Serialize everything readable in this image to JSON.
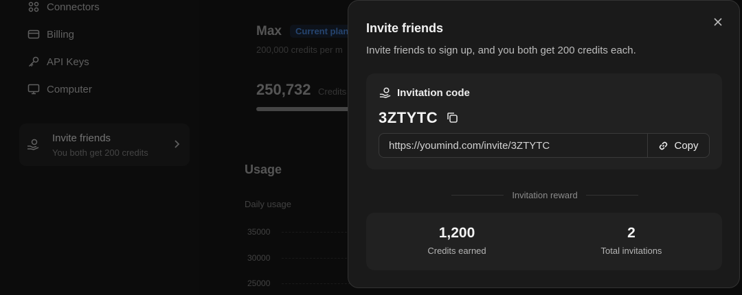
{
  "sidebar": {
    "items": [
      {
        "label": "Connectors",
        "icon": "connectors-icon"
      },
      {
        "label": "Billing",
        "icon": "billing-icon"
      },
      {
        "label": "API Keys",
        "icon": "key-icon"
      },
      {
        "label": "Computer",
        "icon": "monitor-icon"
      }
    ],
    "invite_card": {
      "title": "Invite friends",
      "subtitle": "You both get 200 credits",
      "icon": "hand-coin-icon"
    }
  },
  "main": {
    "plan": {
      "name": "Max",
      "badge": "Current plan",
      "subtitle": "200,000 credits per m"
    },
    "credits": {
      "value": "250,732",
      "label": "Credits"
    },
    "usage_title": "Usage",
    "daily_usage_label": "Daily usage",
    "axis_ticks": [
      "35000",
      "30000",
      "25000"
    ]
  },
  "modal": {
    "title": "Invite friends",
    "description": "Invite friends to sign up, and you both get 200 credits each.",
    "code_section": {
      "header": "Invitation code",
      "code": "3ZTYTC",
      "link": "https://youmind.com/invite/3ZTYTC",
      "copy_label": "Copy"
    },
    "reward_section_label": "Invitation reward",
    "stats": [
      {
        "value": "1,200",
        "label": "Credits earned"
      },
      {
        "value": "2",
        "label": "Total invitations"
      }
    ]
  },
  "colors": {
    "modal_bg": "#1a1a1a",
    "card_bg": "#212121",
    "badge_text": "#3d6fb3",
    "page_bg": "#131313"
  }
}
